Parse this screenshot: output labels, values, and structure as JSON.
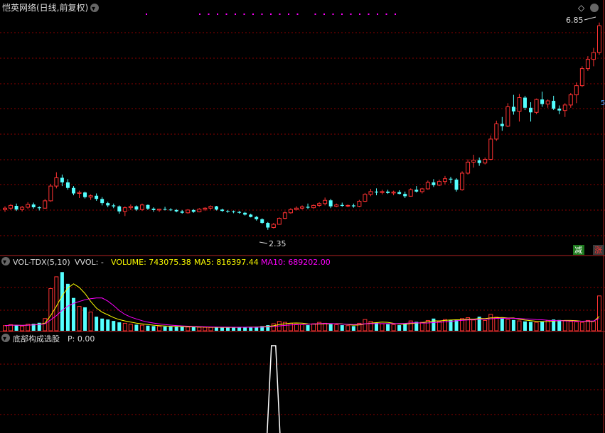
{
  "main_panel": {
    "title": "恺英网络(日线,前复权)",
    "max_label": "6.85",
    "min_label": "2.35",
    "right_marker": "5",
    "btn_minus": "减",
    "btn_plus": "涨",
    "diamond_glyph": "◇",
    "collapse_glyph": "▾"
  },
  "vol_panel": {
    "indicator": "VOL-TDX(5,10)",
    "vvol": "VVOL: -",
    "volume_label": "VOLUME: 743075.38",
    "ma5_label": "MA5: 816397.44",
    "ma10_label": "MA10: 689202.00"
  },
  "signal_panel": {
    "title": "底部构成选股",
    "p_label": "P: 0.00"
  },
  "colors": {
    "up": "#ff3232",
    "down": "#54ffff",
    "ma5": "#ffff00",
    "ma10": "#ff00ff",
    "grid": "#8b0000",
    "text": "#dddddd",
    "marker": "#ff00ff",
    "signal": "#ffffff"
  },
  "chart_data": [
    {
      "type": "candlestick",
      "title": "恺英网络(日线,前复权)",
      "ylim": [
        2.1,
        7.0
      ],
      "max_marked": 6.85,
      "min_marked": 2.35,
      "ohlc": [
        [
          2.79,
          2.86,
          2.74,
          2.82
        ],
        [
          2.82,
          2.91,
          2.78,
          2.88
        ],
        [
          2.87,
          2.92,
          2.76,
          2.79
        ],
        [
          2.79,
          2.87,
          2.75,
          2.84
        ],
        [
          2.84,
          2.95,
          2.8,
          2.9
        ],
        [
          2.9,
          2.94,
          2.81,
          2.84
        ],
        [
          2.84,
          2.86,
          2.77,
          2.82
        ],
        [
          2.82,
          3.02,
          2.81,
          2.98
        ],
        [
          2.98,
          3.35,
          2.96,
          3.3
        ],
        [
          3.3,
          3.6,
          3.25,
          3.48
        ],
        [
          3.48,
          3.55,
          3.3,
          3.38
        ],
        [
          3.38,
          3.45,
          3.22,
          3.26
        ],
        [
          3.26,
          3.3,
          3.1,
          3.14
        ],
        [
          3.14,
          3.2,
          3.04,
          3.16
        ],
        [
          3.16,
          3.18,
          3.03,
          3.06
        ],
        [
          3.06,
          3.12,
          3.0,
          3.09
        ],
        [
          3.09,
          3.14,
          2.98,
          3.02
        ],
        [
          3.02,
          3.06,
          2.88,
          2.93
        ],
        [
          2.93,
          2.96,
          2.84,
          2.88
        ],
        [
          2.88,
          2.92,
          2.82,
          2.86
        ],
        [
          2.86,
          2.88,
          2.7,
          2.75
        ],
        [
          2.75,
          2.86,
          2.65,
          2.83
        ],
        [
          2.83,
          2.9,
          2.78,
          2.86
        ],
        [
          2.86,
          2.88,
          2.76,
          2.79
        ],
        [
          2.79,
          2.92,
          2.76,
          2.89
        ],
        [
          2.89,
          2.9,
          2.78,
          2.81
        ],
        [
          2.81,
          2.84,
          2.74,
          2.78
        ],
        [
          2.78,
          2.81,
          2.74,
          2.8
        ],
        [
          2.8,
          2.85,
          2.77,
          2.79
        ],
        [
          2.79,
          2.82,
          2.76,
          2.78
        ],
        [
          2.78,
          2.8,
          2.73,
          2.75
        ],
        [
          2.75,
          2.78,
          2.7,
          2.72
        ],
        [
          2.72,
          2.8,
          2.7,
          2.78
        ],
        [
          2.78,
          2.8,
          2.72,
          2.74
        ],
        [
          2.74,
          2.82,
          2.73,
          2.8
        ],
        [
          2.8,
          2.84,
          2.76,
          2.82
        ],
        [
          2.82,
          2.88,
          2.79,
          2.86
        ],
        [
          2.86,
          2.87,
          2.77,
          2.79
        ],
        [
          2.79,
          2.81,
          2.74,
          2.76
        ],
        [
          2.76,
          2.78,
          2.72,
          2.75
        ],
        [
          2.75,
          2.77,
          2.71,
          2.74
        ],
        [
          2.74,
          2.76,
          2.7,
          2.72
        ],
        [
          2.72,
          2.74,
          2.66,
          2.68
        ],
        [
          2.68,
          2.7,
          2.62,
          2.63
        ],
        [
          2.63,
          2.65,
          2.55,
          2.58
        ],
        [
          2.58,
          2.6,
          2.48,
          2.5
        ],
        [
          2.5,
          2.52,
          2.35,
          2.4
        ],
        [
          2.4,
          2.5,
          2.38,
          2.47
        ],
        [
          2.47,
          2.62,
          2.46,
          2.6
        ],
        [
          2.6,
          2.75,
          2.58,
          2.72
        ],
        [
          2.72,
          2.82,
          2.7,
          2.79
        ],
        [
          2.79,
          2.86,
          2.77,
          2.82
        ],
        [
          2.82,
          2.88,
          2.79,
          2.85
        ],
        [
          2.85,
          2.92,
          2.8,
          2.83
        ],
        [
          2.83,
          2.9,
          2.81,
          2.88
        ],
        [
          2.88,
          2.95,
          2.85,
          2.92
        ],
        [
          2.92,
          3.05,
          2.88,
          2.99
        ],
        [
          2.99,
          3.02,
          2.82,
          2.86
        ],
        [
          2.86,
          2.92,
          2.84,
          2.89
        ],
        [
          2.89,
          2.94,
          2.85,
          2.87
        ],
        [
          2.87,
          2.9,
          2.84,
          2.88
        ],
        [
          2.88,
          2.92,
          2.83,
          2.86
        ],
        [
          2.86,
          3.0,
          2.84,
          2.97
        ],
        [
          2.97,
          3.15,
          2.95,
          3.12
        ],
        [
          3.12,
          3.24,
          3.08,
          3.18
        ],
        [
          3.18,
          3.25,
          3.1,
          3.16
        ],
        [
          3.16,
          3.22,
          3.12,
          3.18
        ],
        [
          3.18,
          3.22,
          3.13,
          3.15
        ],
        [
          3.15,
          3.2,
          3.1,
          3.17
        ],
        [
          3.17,
          3.21,
          3.12,
          3.13
        ],
        [
          3.13,
          3.18,
          3.04,
          3.08
        ],
        [
          3.08,
          3.25,
          3.07,
          3.22
        ],
        [
          3.22,
          3.3,
          3.16,
          3.18
        ],
        [
          3.18,
          3.26,
          3.14,
          3.24
        ],
        [
          3.24,
          3.42,
          3.22,
          3.38
        ],
        [
          3.38,
          3.45,
          3.28,
          3.32
        ],
        [
          3.32,
          3.44,
          3.3,
          3.4
        ],
        [
          3.4,
          3.52,
          3.34,
          3.46
        ],
        [
          3.46,
          3.5,
          3.36,
          3.44
        ],
        [
          3.44,
          3.47,
          3.18,
          3.22
        ],
        [
          3.22,
          3.62,
          3.2,
          3.58
        ],
        [
          3.58,
          3.88,
          3.55,
          3.82
        ],
        [
          3.82,
          3.98,
          3.7,
          3.86
        ],
        [
          3.86,
          3.92,
          3.74,
          3.8
        ],
        [
          3.8,
          3.92,
          3.77,
          3.88
        ],
        [
          3.88,
          4.4,
          3.86,
          4.32
        ],
        [
          4.32,
          4.72,
          4.28,
          4.65
        ],
        [
          4.65,
          4.8,
          4.5,
          4.6
        ],
        [
          4.6,
          5.1,
          4.58,
          5.02
        ],
        [
          5.02,
          5.28,
          4.85,
          4.92
        ],
        [
          4.92,
          5.3,
          4.7,
          5.22
        ],
        [
          5.22,
          5.26,
          4.95,
          5.0
        ],
        [
          5.0,
          5.12,
          4.7,
          4.9
        ],
        [
          4.9,
          5.2,
          4.86,
          5.18
        ],
        [
          5.18,
          5.35,
          5.02,
          5.08
        ],
        [
          5.08,
          5.18,
          5.0,
          5.15
        ],
        [
          5.15,
          5.26,
          4.95,
          4.98
        ],
        [
          4.98,
          5.05,
          4.86,
          4.94
        ],
        [
          4.94,
          5.1,
          4.8,
          5.06
        ],
        [
          5.06,
          5.32,
          5.0,
          5.28
        ],
        [
          5.28,
          5.55,
          5.1,
          5.48
        ],
        [
          5.48,
          5.9,
          5.45,
          5.85
        ],
        [
          5.85,
          6.12,
          5.8,
          6.05
        ],
        [
          6.05,
          6.3,
          5.9,
          6.2
        ],
        [
          6.2,
          6.85,
          6.15,
          6.78
        ]
      ],
      "top_markers": [
        12,
        18,
        19,
        20,
        21,
        22,
        23,
        24,
        25,
        26,
        27,
        28,
        29,
        31,
        32,
        33,
        34,
        35,
        36,
        37,
        38,
        39,
        40
      ]
    },
    {
      "type": "bar",
      "title": "VOL-TDX(5,10)",
      "ylim": [
        0,
        1300000
      ],
      "volume": [
        110000,
        130000,
        120000,
        100000,
        140000,
        150000,
        170000,
        260000,
        900000,
        1150000,
        1250000,
        1000000,
        700000,
        520000,
        500000,
        400000,
        300000,
        260000,
        240000,
        210000,
        180000,
        160000,
        140000,
        130000,
        120000,
        110000,
        100000,
        95000,
        90000,
        88000,
        85000,
        83000,
        80000,
        78000,
        76000,
        74000,
        72000,
        70000,
        72000,
        74000,
        76000,
        78000,
        80000,
        82000,
        85000,
        100000,
        120000,
        150000,
        200000,
        180000,
        160000,
        140000,
        130000,
        120000,
        150000,
        180000,
        160000,
        140000,
        130000,
        120000,
        110000,
        100000,
        160000,
        240000,
        200000,
        170000,
        150000,
        140000,
        130000,
        120000,
        160000,
        210000,
        190000,
        180000,
        220000,
        260000,
        200000,
        240000,
        230000,
        240000,
        260000,
        280000,
        230000,
        300000,
        220000,
        350000,
        290000,
        260000,
        240000,
        230000,
        210000,
        200000,
        190000,
        180000,
        200000,
        220000,
        240000,
        230000,
        210000,
        200000,
        190000,
        180000,
        220000,
        200000,
        743075.38
      ],
      "ma5_last": 816397.44,
      "ma10_last": 689202.0
    },
    {
      "type": "line",
      "title": "底部构成选股",
      "ylim": [
        0,
        1
      ],
      "signal": [
        {
          "index": 47,
          "value": 1
        }
      ],
      "p_last": 0.0
    }
  ]
}
